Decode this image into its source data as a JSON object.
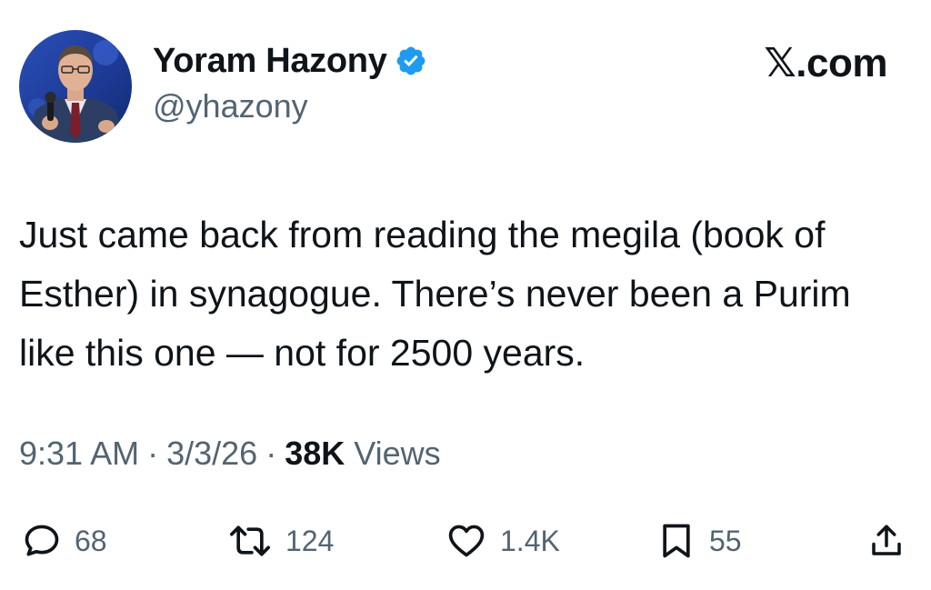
{
  "author": {
    "display_name": "Yoram Hazony",
    "handle": "@yhazony",
    "verified": true,
    "avatar_icon": "profile-photo-speaker-with-microphone"
  },
  "site_label": "𝕏.com",
  "tweet": {
    "text": "Just came back from reading the megila (book of Esther) in synagogue. There’s never been a Purim like this one — not for 2500 years."
  },
  "meta": {
    "time": "9:31 AM",
    "separator": "·",
    "date": "3/3/26",
    "views_count": "38K",
    "views_label": "Views"
  },
  "actions": {
    "replies": "68",
    "retweets": "124",
    "likes": "1.4K",
    "bookmarks": "55"
  },
  "colors": {
    "text": "#0f1419",
    "secondary": "#536471",
    "verified": "#1d9bf0"
  }
}
